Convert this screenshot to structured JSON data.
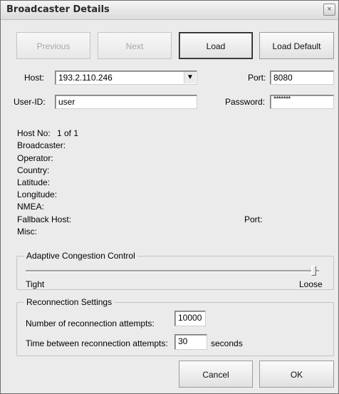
{
  "window": {
    "title": "Broadcaster Details",
    "close_glyph": "×"
  },
  "toolbar": {
    "previous": "Previous",
    "next": "Next",
    "load": "Load",
    "load_default": "Load Default"
  },
  "connection": {
    "host_label": "Host:",
    "host_value": "193.2.110.246",
    "port_label": "Port:",
    "port_value": "8080",
    "userid_label": "User-ID:",
    "userid_value": "user",
    "password_label": "Password:",
    "password_value": "*******"
  },
  "details": {
    "host_no_label": "Host No:",
    "host_no_value": "1 of 1",
    "broadcaster_label": "Broadcaster:",
    "operator_label": "Operator:",
    "country_label": "Country:",
    "latitude_label": "Latitude:",
    "longitude_label": "Longitude:",
    "nmea_label": "NMEA:",
    "fallback_host_label": "Fallback Host:",
    "fallback_port_label": "Port:",
    "misc_label": "Misc:"
  },
  "congestion": {
    "group_label": "Adaptive Congestion Control",
    "min_label": "Tight",
    "max_label": "Loose",
    "level": 1.0
  },
  "reconnection": {
    "group_label": "Reconnection Settings",
    "attempts_label": "Number of reconnection attempts:",
    "attempts_value": "10000",
    "interval_label": "Time between reconnection attempts:",
    "interval_value": "30",
    "interval_unit": "seconds"
  },
  "footer": {
    "cancel": "Cancel",
    "ok": "OK"
  }
}
